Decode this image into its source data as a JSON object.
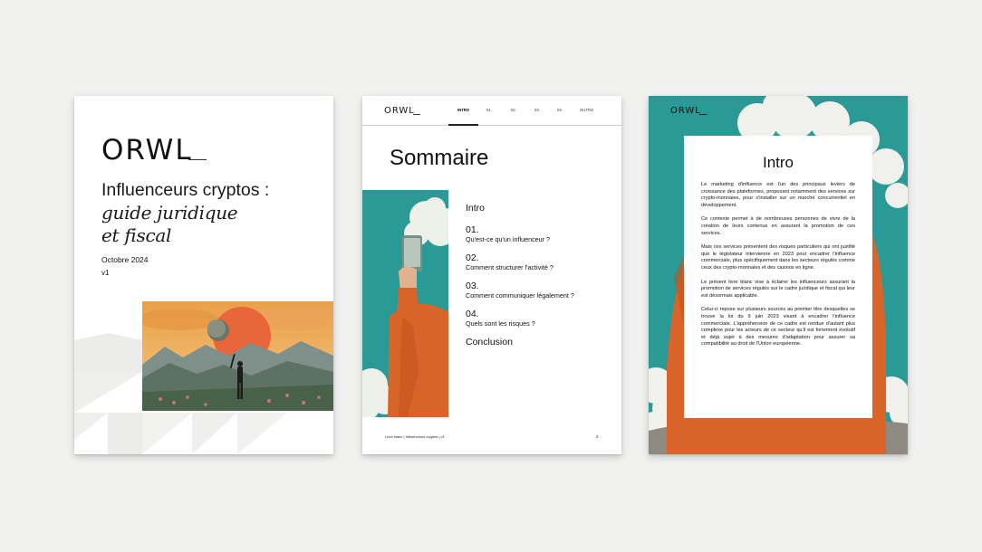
{
  "cover": {
    "logo": "ORWL",
    "title_line1": "Influenceurs cryptos :",
    "title_line2": "guide juridique",
    "title_line3": "et fiscal",
    "date": "Octobre 2024",
    "version": "v1"
  },
  "summary_page": {
    "logo": "ORWL",
    "nav_tabs": [
      "INTRO",
      "01.",
      "02.",
      "03.",
      "04.",
      "OUTRO"
    ],
    "active_tab": "INTRO",
    "title": "Sommaire",
    "intro_label": "Intro",
    "items": [
      {
        "num": "01.",
        "label": "Qu'est-ce qu'un influenceur ?"
      },
      {
        "num": "02.",
        "label": "Comment structurer l'activité ?"
      },
      {
        "num": "03.",
        "label": "Comment communiquer légalement ?"
      },
      {
        "num": "04.",
        "label": "Quels sont les risques ?"
      }
    ],
    "conclusion_label": "Conclusion",
    "footer": "Livre blanc | Influenceurs cryptos | v1",
    "page_number": "2"
  },
  "intro_page": {
    "logo": "ORWL",
    "title": "Intro",
    "paragraphs": [
      "Le marketing d'influence est l'un des principaux leviers de croissance des plateformes, proposant notamment des services sur crypto-monnaies, pour s'installer sur un marché concurrentiel en développement.",
      "Ce contexte permet à de nombreuses personnes de vivre de la création de leurs contenus en assurant la promotion de ces services.",
      "Mais ces services présentent des risques particuliers qui ont justifié que le législateur intervienne en 2023 pour encadrer l'influence commerciale, plus spécifiquement dans les secteurs régulés comme ceux des crypto-monnaies et des casinos en ligne.",
      "Le présent livre blanc vise à éclairer les influenceurs assurant la promotion de services régulés sur le cadre juridique et fiscal qui leur est désormais applicable.",
      "Celui-ci repose sur plusieurs sources au premier titre desquelles se trouve la loi du 9 juin 2023 visant à encadrer l'influence commerciale. L'appréhension de ce cadre est rendue d'autant plus complexe pour les acteurs de ce secteur qu'il est fortement évolutif et déjà sujet à des mesures d'adaptation pour assurer sa compatibilité au droit de l'Union européenne."
    ]
  },
  "colors": {
    "background": "#f1f1f0",
    "teal": "#2a9a97",
    "orange": "#d9642a",
    "sun": "#e8663a"
  }
}
